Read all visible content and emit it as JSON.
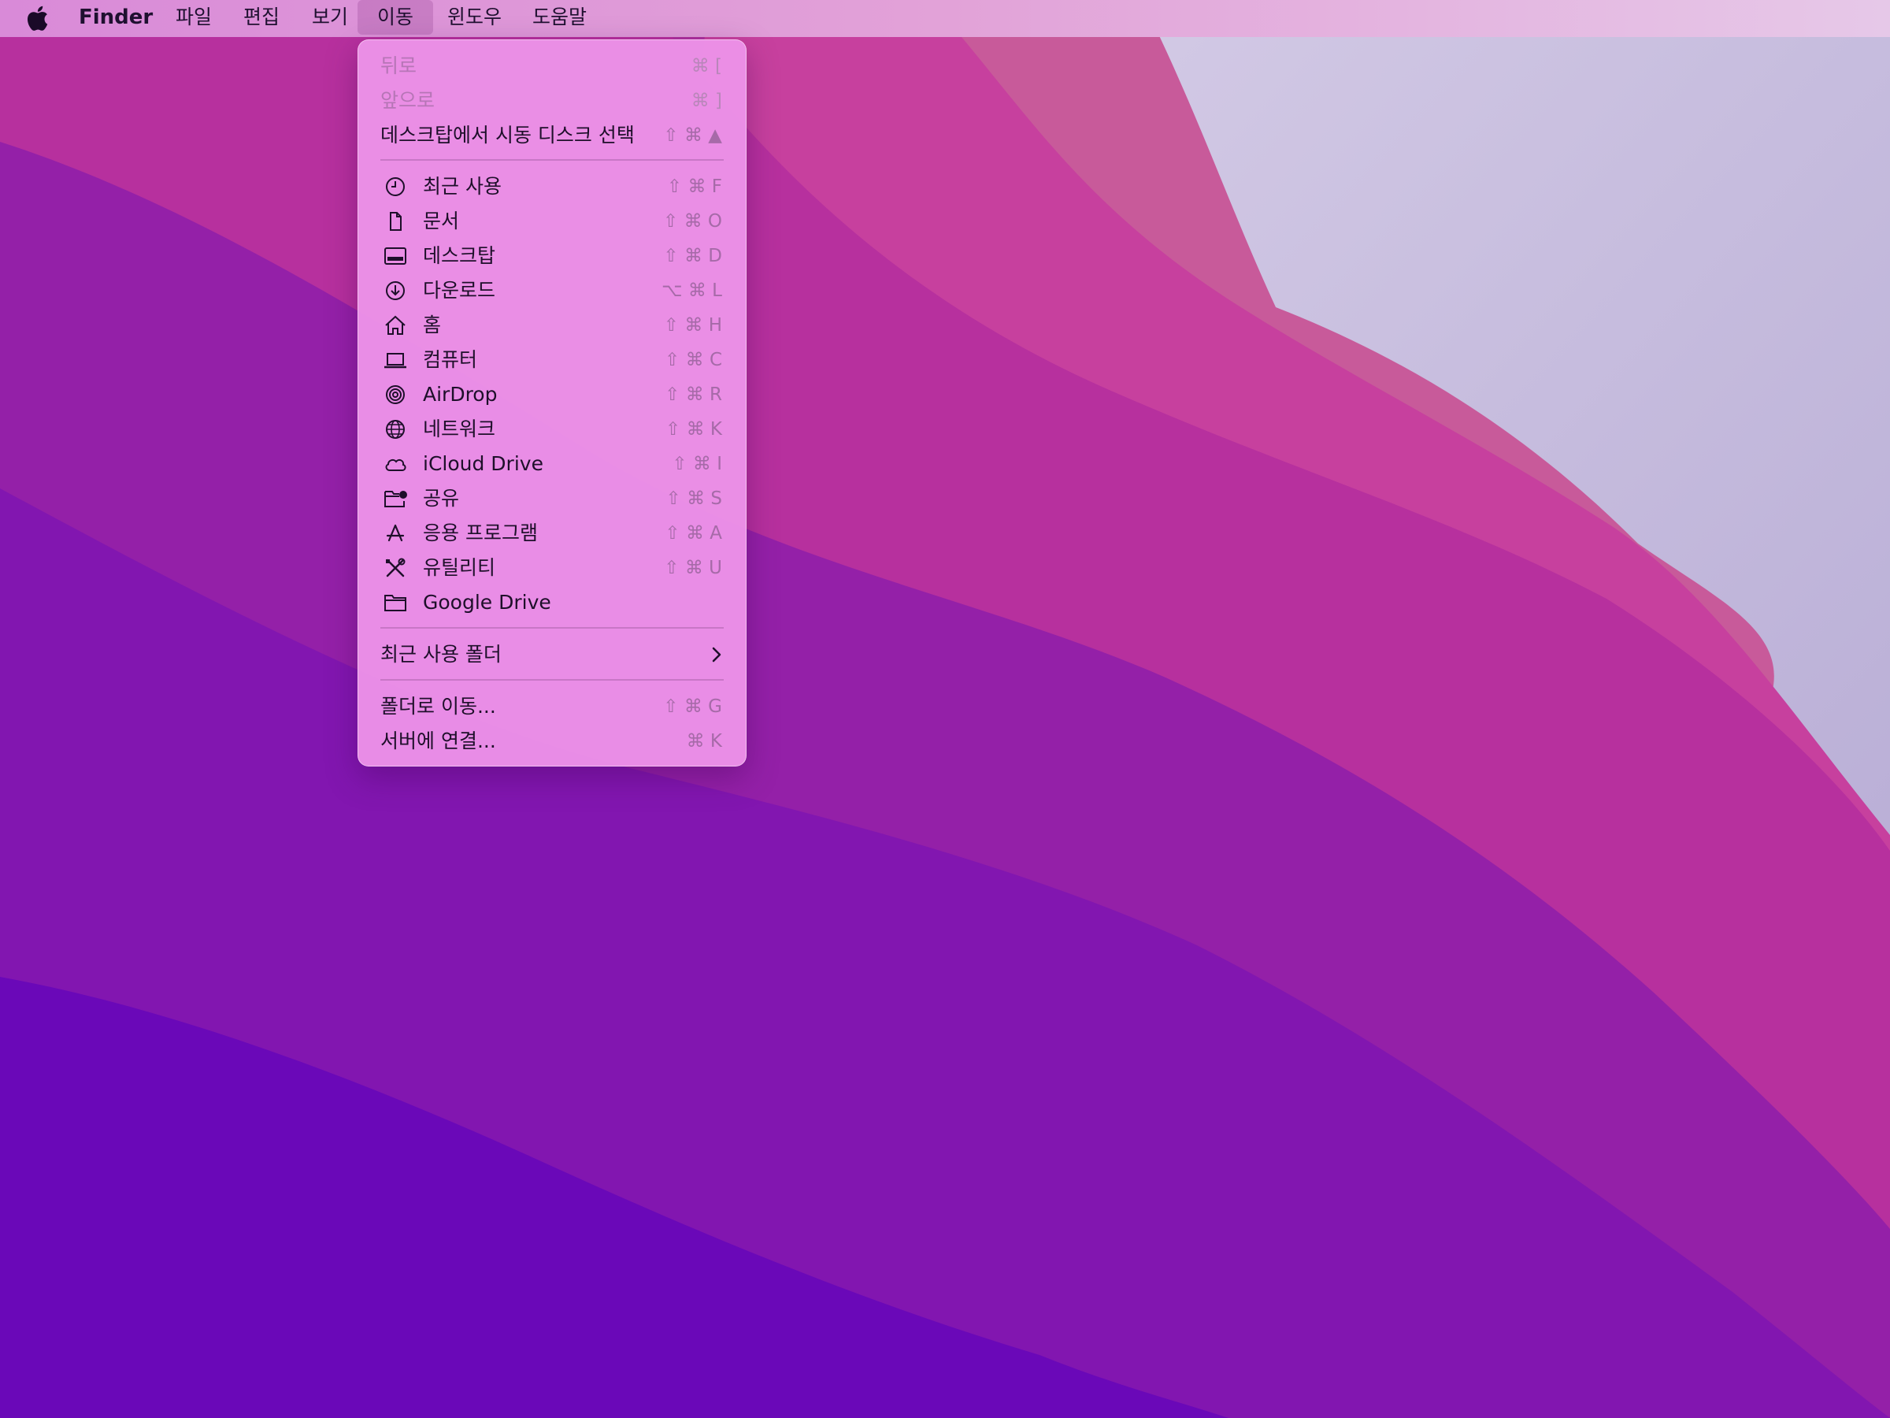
{
  "menubar": {
    "app_name": "Finder",
    "items": [
      "파일",
      "편집",
      "보기",
      "이동",
      "윈도우",
      "도움말"
    ],
    "active_item": "이동"
  },
  "go_menu": {
    "nav": [
      {
        "label": "뒤로",
        "shortcut": "⌘ [",
        "disabled": true
      },
      {
        "label": "앞으로",
        "shortcut": "⌘ ]",
        "disabled": true
      },
      {
        "label": "데스크탑에서 시동 디스크 선택",
        "shortcut": "⇧ ⌘ ▲",
        "disabled": false
      }
    ],
    "places": [
      {
        "label": "최근 사용",
        "shortcut": "⇧ ⌘ F",
        "icon": "clock-icon"
      },
      {
        "label": "문서",
        "shortcut": "⇧ ⌘ O",
        "icon": "document-icon"
      },
      {
        "label": "데스크탑",
        "shortcut": "⇧ ⌘ D",
        "icon": "desktop-icon"
      },
      {
        "label": "다운로드",
        "shortcut": "⌥ ⌘ L",
        "icon": "download-icon"
      },
      {
        "label": "홈",
        "shortcut": "⇧ ⌘ H",
        "icon": "home-icon"
      },
      {
        "label": "컴퓨터",
        "shortcut": "⇧ ⌘ C",
        "icon": "laptop-icon"
      },
      {
        "label": "AirDrop",
        "shortcut": "⇧ ⌘ R",
        "icon": "airdrop-icon"
      },
      {
        "label": "네트워크",
        "shortcut": "⇧ ⌘ K",
        "icon": "globe-icon"
      },
      {
        "label": "iCloud Drive",
        "shortcut": "⇧ ⌘ I",
        "icon": "cloud-icon"
      },
      {
        "label": "공유",
        "shortcut": "⇧ ⌘ S",
        "icon": "shared-folder-icon"
      },
      {
        "label": "응용 프로그램",
        "shortcut": "⇧ ⌘ A",
        "icon": "applications-icon"
      },
      {
        "label": "유틸리티",
        "shortcut": "⇧ ⌘ U",
        "icon": "utilities-icon"
      },
      {
        "label": "Google Drive",
        "shortcut": "",
        "icon": "folder-icon"
      }
    ],
    "recent_folders": {
      "label": "최근 사용 폴더"
    },
    "bottom": [
      {
        "label": "폴더로 이동...",
        "shortcut": "⇧ ⌘ G"
      },
      {
        "label": "서버에 연결...",
        "shortcut": "⌘ K"
      }
    ]
  }
}
